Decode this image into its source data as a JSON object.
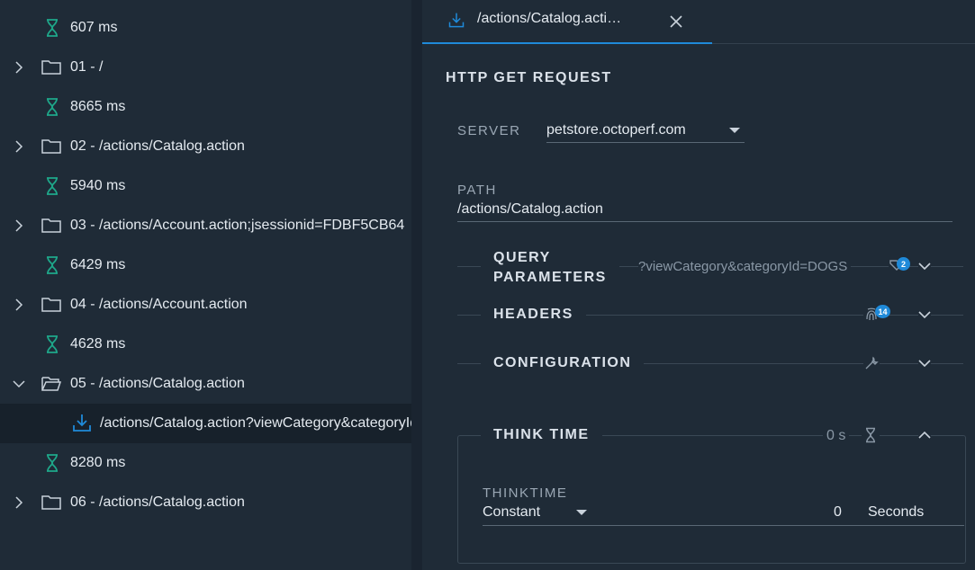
{
  "tree": {
    "items": [
      {
        "kind": "timer",
        "label": "607 ms"
      },
      {
        "kind": "folder",
        "label": "01 - /"
      },
      {
        "kind": "timer",
        "label": "8665 ms"
      },
      {
        "kind": "folder",
        "label": "02 - /actions/Catalog.action"
      },
      {
        "kind": "timer",
        "label": "5940 ms"
      },
      {
        "kind": "folder",
        "label": "03 - /actions/Account.action;jsessionid=FDBF5CB64"
      },
      {
        "kind": "timer",
        "label": "6429 ms"
      },
      {
        "kind": "folder",
        "label": "04 - /actions/Account.action"
      },
      {
        "kind": "timer",
        "label": "4628 ms"
      },
      {
        "kind": "folder-open",
        "label": "05 - /actions/Catalog.action"
      },
      {
        "kind": "request",
        "label": "/actions/Catalog.action?viewCategory&categoryId=DOGS"
      },
      {
        "kind": "timer",
        "label": "8280 ms"
      },
      {
        "kind": "folder",
        "label": "06 - /actions/Catalog.action"
      }
    ]
  },
  "tab": {
    "label": "/actions/Catalog.acti…"
  },
  "request": {
    "title": "HTTP GET REQUEST",
    "server_label": "SERVER",
    "server_value": "petstore.octoperf.com",
    "path_label": "PATH",
    "path_value": "/actions/Catalog.action"
  },
  "sections": {
    "query": {
      "label_line1": "QUERY",
      "label_line2": "PARAMETERS",
      "summary": "?viewCategory&categoryId=DOGS",
      "badge": "2"
    },
    "headers": {
      "label": "HEADERS",
      "badge": "14"
    },
    "configuration": {
      "label": "CONFIGURATION"
    },
    "think_time": {
      "label": "THINK TIME",
      "summary": "0 s"
    }
  },
  "thinktime": {
    "label": "THINKTIME",
    "type_value": "Constant",
    "amount": "0",
    "unit": "Seconds"
  },
  "colors": {
    "accent": "#1f8ad9",
    "timer": "#1ea88a",
    "background": "#1f2b37"
  }
}
